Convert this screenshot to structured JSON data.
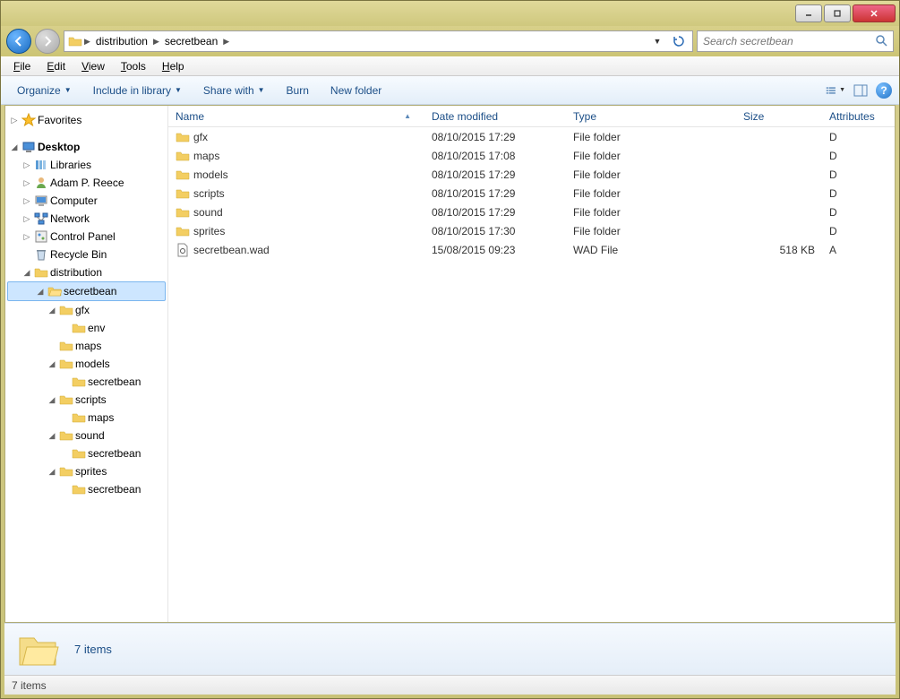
{
  "titlebar": {
    "minimize": "minimize",
    "maximize": "maximize",
    "close": "close"
  },
  "nav": {
    "back": "back",
    "forward": "forward"
  },
  "breadcrumb": {
    "items": [
      "distribution",
      "secretbean"
    ]
  },
  "search": {
    "placeholder": "Search secretbean"
  },
  "menubar": {
    "file": "File",
    "edit": "Edit",
    "view": "View",
    "tools": "Tools",
    "help": "Help"
  },
  "toolbar": {
    "organize": "Organize",
    "include": "Include in library",
    "share": "Share with",
    "burn": "Burn",
    "newfolder": "New folder"
  },
  "columns": {
    "name": "Name",
    "date": "Date modified",
    "type": "Type",
    "size": "Size",
    "attr": "Attributes"
  },
  "files": [
    {
      "name": "gfx",
      "date": "08/10/2015 17:29",
      "type": "File folder",
      "size": "",
      "attr": "D",
      "icon": "folder"
    },
    {
      "name": "maps",
      "date": "08/10/2015 17:08",
      "type": "File folder",
      "size": "",
      "attr": "D",
      "icon": "folder"
    },
    {
      "name": "models",
      "date": "08/10/2015 17:29",
      "type": "File folder",
      "size": "",
      "attr": "D",
      "icon": "folder"
    },
    {
      "name": "scripts",
      "date": "08/10/2015 17:29",
      "type": "File folder",
      "size": "",
      "attr": "D",
      "icon": "folder"
    },
    {
      "name": "sound",
      "date": "08/10/2015 17:29",
      "type": "File folder",
      "size": "",
      "attr": "D",
      "icon": "folder"
    },
    {
      "name": "sprites",
      "date": "08/10/2015 17:30",
      "type": "File folder",
      "size": "",
      "attr": "D",
      "icon": "folder"
    },
    {
      "name": "secretbean.wad",
      "date": "15/08/2015 09:23",
      "type": "WAD File",
      "size": "518 KB",
      "attr": "A",
      "icon": "file"
    }
  ],
  "tree": {
    "favorites": "Favorites",
    "desktop": "Desktop",
    "libraries": "Libraries",
    "user": "Adam P. Reece",
    "computer": "Computer",
    "network": "Network",
    "controlpanel": "Control Panel",
    "recyclebin": "Recycle Bin",
    "distribution": "distribution",
    "secretbean": "secretbean",
    "gfx": "gfx",
    "env": "env",
    "maps": "maps",
    "models": "models",
    "scripts": "scripts",
    "sound": "sound",
    "sprites": "sprites"
  },
  "details": {
    "text": "7 items"
  },
  "statusbar": {
    "text": "7 items"
  }
}
